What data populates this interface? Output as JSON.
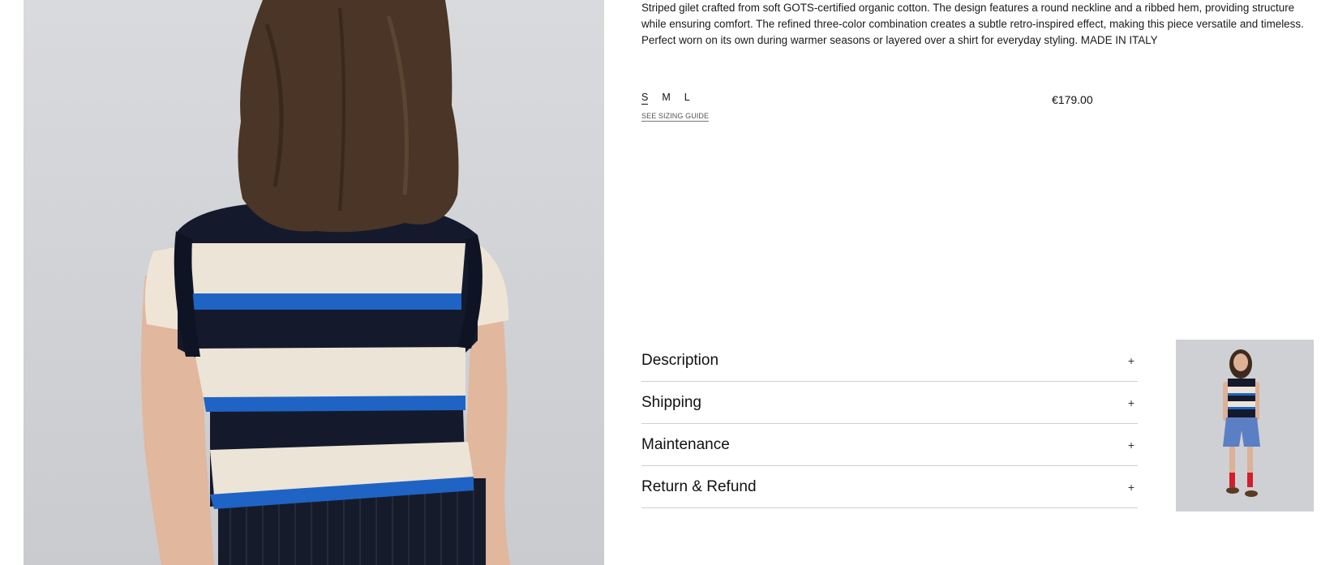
{
  "product": {
    "description": "Striped gilet crafted from soft GOTS-certified organic cotton. The design features a round neckline and a ribbed hem, providing structure while ensuring comfort. The refined three-color combination creates a subtle retro-inspired effect, making this piece versatile and timeless. Perfect worn on its own during warmer seasons or layered over a shirt for everyday styling. MADE IN ITALY",
    "sizes": [
      "S",
      "M",
      "L"
    ],
    "selected_size": "S",
    "sizing_guide_label": "SEE SIZING GUIDE",
    "price": "€179.00"
  },
  "accordion": [
    {
      "label": "Description",
      "icon": "plus-icon",
      "symbol": "+"
    },
    {
      "label": "Shipping",
      "icon": "plus-icon",
      "symbol": "+"
    },
    {
      "label": "Maintenance",
      "icon": "plus-icon",
      "symbol": "+"
    },
    {
      "label": "Return & Refund",
      "icon": "plus-icon",
      "symbol": "+"
    }
  ],
  "colors": {
    "navy": "#141a2c",
    "cream": "#ece4d6",
    "blue": "#1f64c4",
    "hair": "#4a3526",
    "skin": "#e3b99f",
    "background": "#d3d5d9"
  }
}
